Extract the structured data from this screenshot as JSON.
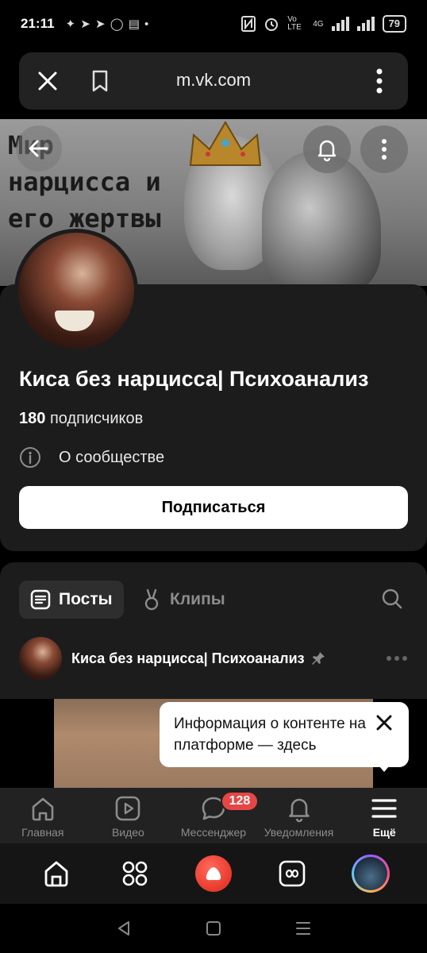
{
  "status_bar": {
    "time": "21:11",
    "left_icons": "✦ ➤ ➤ ◯ ▤ •",
    "network": "Vo LTE",
    "network_type": "4G",
    "battery": "79"
  },
  "browser": {
    "url": "m.vk.com"
  },
  "cover": {
    "text_lines": [
      "Мир",
      "нарцисса и",
      "его жертвы"
    ]
  },
  "community": {
    "name": "Киса без нарцисса| Психоанализ",
    "subscribers_count": "180",
    "subscribers_label": "подписчиков",
    "about_label": "О сообществе",
    "subscribe_label": "Подписаться"
  },
  "feed_tabs": {
    "posts_label": "Посты",
    "clips_label": "Клипы"
  },
  "post": {
    "author": "Киса без нарцисса| Психоанализ"
  },
  "tooltip": {
    "text": "Информация о контенте на платформе — здесь"
  },
  "tabbar": {
    "items": [
      {
        "label": "Главная",
        "icon": "home-icon"
      },
      {
        "label": "Видео",
        "icon": "video-icon"
      },
      {
        "label": "Мессенджер",
        "icon": "messenger-icon",
        "badge": "128"
      },
      {
        "label": "Уведомления",
        "icon": "bell-icon"
      },
      {
        "label": "Ещё",
        "icon": "menu-icon",
        "active": true
      }
    ]
  },
  "colors": {
    "background": "#000000",
    "card": "#1c1c1c",
    "badge": "#e64646",
    "accent_alice": "#e8392c"
  }
}
